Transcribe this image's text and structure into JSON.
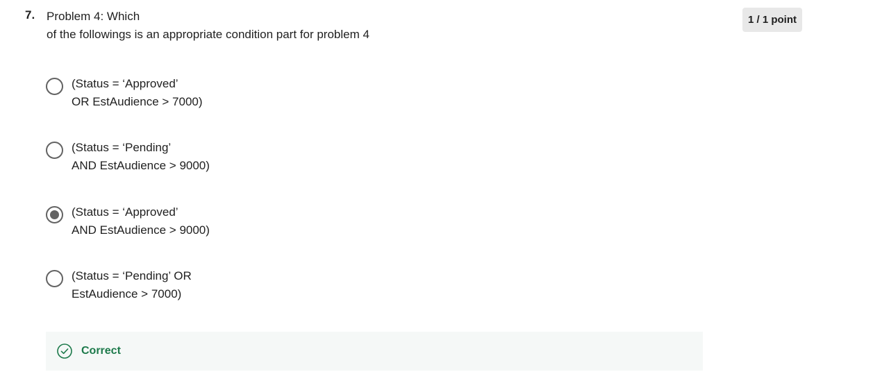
{
  "question": {
    "number": "7.",
    "title_line1": "Problem 4: Which",
    "title_line2": "of the followings is an appropriate condition part for problem 4",
    "points": "1 / 1 point"
  },
  "options": [
    {
      "line1": "(Status = ‘Approved’",
      "line2": "OR EstAudience > 7000)",
      "selected": false
    },
    {
      "line1": "(Status = ‘Pending’",
      "line2": "AND EstAudience > 9000)",
      "selected": false
    },
    {
      "line1": "(Status = ‘Approved’",
      "line2": "AND EstAudience > 9000)",
      "selected": true
    },
    {
      "line1": "(Status = ‘Pending’ OR",
      "line2": "EstAudience > 7000)",
      "selected": false
    }
  ],
  "feedback": {
    "label": "Correct",
    "icon": "check-circle-icon",
    "color": "#1d7a4b"
  }
}
